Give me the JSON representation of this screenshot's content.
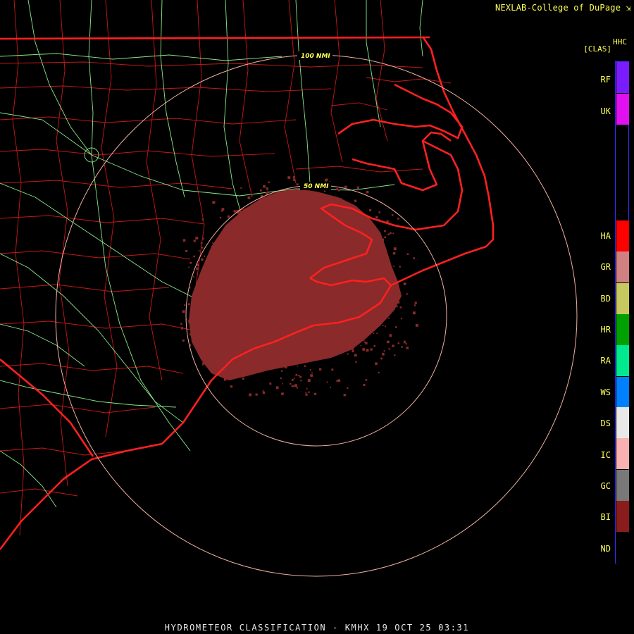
{
  "credit": "NEXLAB-College of DuPage",
  "product": {
    "code": "HHC",
    "bracket": "[CLAS]"
  },
  "footer_title": "HYDROMETEOR CLASSIFICATION - KMHX 19 OCT 25 03:31",
  "range_rings": [
    {
      "label": "50 NMI",
      "nmi": 50
    },
    {
      "label": "100 NMI",
      "nmi": 100
    }
  ],
  "legend": [
    {
      "code": "RF",
      "color": "#7a1cff"
    },
    {
      "code": "UK",
      "color": "#e010f0"
    },
    {
      "code": "HA",
      "color": "#ff0000"
    },
    {
      "code": "GR",
      "color": "#d08080"
    },
    {
      "code": "BD",
      "color": "#c8c860"
    },
    {
      "code": "HR",
      "color": "#00a000"
    },
    {
      "code": "RA",
      "color": "#00e890"
    },
    {
      "code": "WS",
      "color": "#0080ff"
    },
    {
      "code": "DS",
      "color": "#e8e8e8"
    },
    {
      "code": "IC",
      "color": "#f8b0b0"
    },
    {
      "code": "GC",
      "color": "#787878"
    },
    {
      "code": "BI",
      "color": "#8a1c1c"
    },
    {
      "code": "ND",
      "color": "#000000"
    }
  ],
  "colors": {
    "background": "#000000",
    "state_border": "#ff2020",
    "county_line": "#c81818",
    "highway": "#88e888",
    "range_ring": "#f0b0a0",
    "echo": "#8a2a2a",
    "label": "#ffff55"
  }
}
